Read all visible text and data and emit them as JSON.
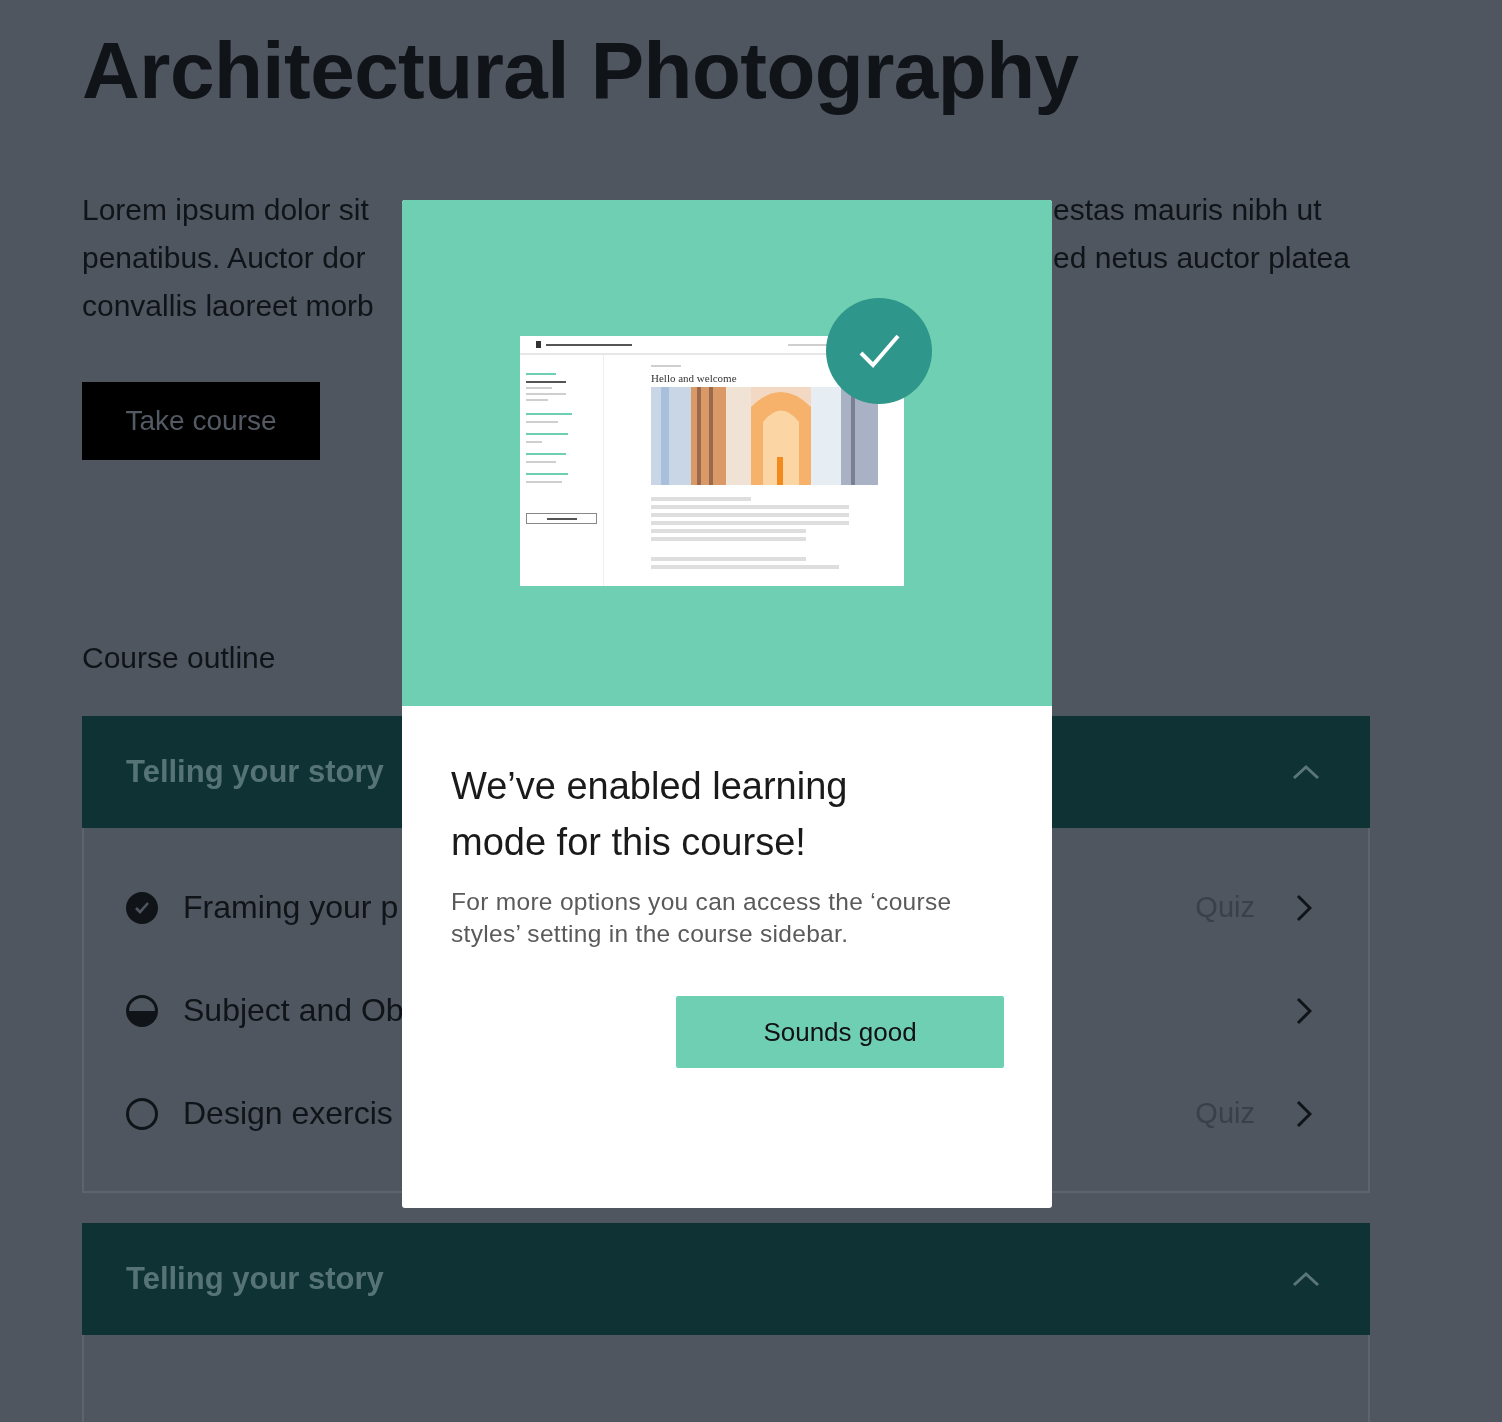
{
  "page": {
    "title": "Architectural Photography",
    "intro_lines": [
      {
        "left": "Lorem ipsum dolor sit",
        "right": "estas mauris nibh ut"
      },
      {
        "left": "penatibus. Auctor dor",
        "right": "ed netus auctor platea"
      },
      {
        "left": "convallis laoreet morb"
      }
    ],
    "cta": "Take course",
    "outline_heading": "Course outline",
    "sections": [
      {
        "title": "Telling your story",
        "expanded": true,
        "lessons": [
          {
            "title": "Framing your p",
            "kind": "complete",
            "tag": "Quiz"
          },
          {
            "title": "Subject and Ob",
            "kind": "partial"
          },
          {
            "title": "Design exercis",
            "kind": "none",
            "tag": "Quiz"
          }
        ]
      },
      {
        "title": "Telling your story",
        "expanded": true
      }
    ]
  },
  "modal": {
    "preview": {
      "heading": "Hello and welcome"
    },
    "title": "We’ve enabled learning mode for this course!",
    "body": "For more options you can access the ‘course styles’ setting in the course sidebar.",
    "button": "Sounds good"
  }
}
